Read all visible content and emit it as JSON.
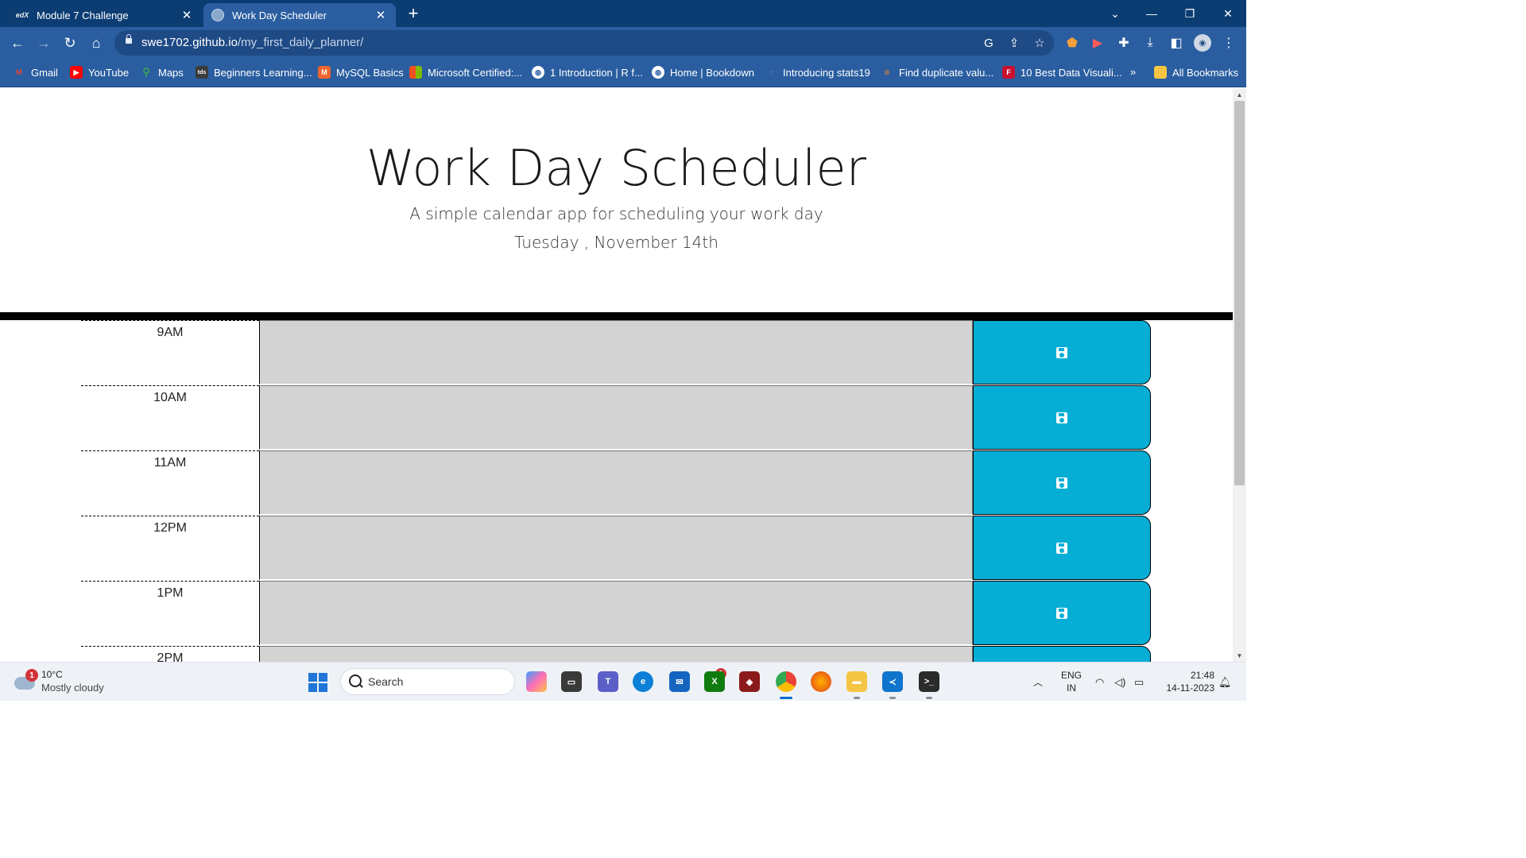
{
  "browser": {
    "tabs": [
      {
        "title": "Module 7 Challenge",
        "favicon": "edx",
        "active": false
      },
      {
        "title": "Work Day Scheduler",
        "favicon": "globe-icon",
        "active": true
      }
    ],
    "url_host": "swe1702.github.io",
    "url_path": "/my_first_daily_planner/",
    "bookmarks": [
      {
        "label": "Gmail",
        "icon": "gmail-icon",
        "color": "#ea4335"
      },
      {
        "label": "YouTube",
        "icon": "youtube-icon",
        "color": "#ff0000"
      },
      {
        "label": "Maps",
        "icon": "maps-icon",
        "color": "#34a853"
      },
      {
        "label": "Beginners Learning...",
        "icon": "tds-icon",
        "color": "#3b3b3b"
      },
      {
        "label": "MySQL Basics",
        "icon": "mysql-icon",
        "color": "#f0652f"
      },
      {
        "label": "Microsoft Certified:...",
        "icon": "microsoft-icon",
        "color": "#f25022"
      },
      {
        "label": "1 Introduction | R f...",
        "icon": "globe-icon",
        "color": "#ffffff"
      },
      {
        "label": "Home | Bookdown",
        "icon": "globe-icon",
        "color": "#ffffff"
      },
      {
        "label": "Introducing stats19",
        "icon": "stats19-icon",
        "color": "#6ea0d8"
      },
      {
        "label": "Find duplicate valu...",
        "icon": "stackoverflow-icon",
        "color": "#f48024"
      },
      {
        "label": "10 Best Data Visuali...",
        "icon": "f-icon",
        "color": "#c8102e"
      }
    ],
    "overflow_label": "»",
    "all_bookmarks_label": "All Bookmarks"
  },
  "page": {
    "title": "Work Day Scheduler",
    "lead": "A simple calendar app for scheduling your work day",
    "current_day": "Tuesday , November 14th",
    "hours": [
      {
        "label": "9AM",
        "text": ""
      },
      {
        "label": "10AM",
        "text": ""
      },
      {
        "label": "11AM",
        "text": ""
      },
      {
        "label": "12PM",
        "text": ""
      },
      {
        "label": "1PM",
        "text": ""
      },
      {
        "label": "2PM",
        "text": ""
      }
    ],
    "colors": {
      "save": "#06aed5",
      "past": "#d3d3d3",
      "divider": "#000000"
    }
  },
  "taskbar": {
    "weather_temp": "10°C",
    "weather_desc": "Mostly cloudy",
    "weather_badge": "1",
    "search_placeholder": "Search",
    "teams_badge": "1",
    "lang_line1": "ENG",
    "lang_line2": "IN",
    "time": "21:48",
    "date": "14-11-2023"
  }
}
